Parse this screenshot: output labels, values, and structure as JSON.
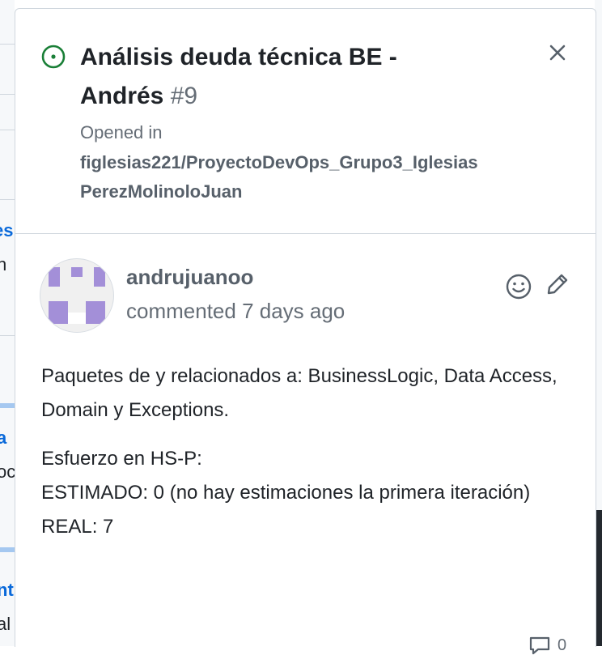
{
  "background": {
    "left_fragments": [
      "es",
      "n",
      "a",
      "oc",
      "nt",
      "al"
    ]
  },
  "issue": {
    "title": "Análisis deuda técnica BE - Andrés",
    "number": "#9",
    "opened_label": "Opened in",
    "repository": "figlesias221/ProyectoDevOps_Grupo3_IglesiasPerezMolinoloJuan",
    "status_color": "#1a7f37"
  },
  "comment": {
    "author": "andrujuanoo",
    "meta": "commented 7 days ago",
    "paragraph_1": "Paquetes de y relacionados a: BusinessLogic, Data Access, Domain y Exceptions.",
    "line_1": "Esfuerzo en HS-P:",
    "line_2": "ESTIMADO: 0 (no hay estimaciones la primera iteración)",
    "line_3": "REAL: 7",
    "reply_count": "0",
    "avatar_color": "#a38fd8"
  },
  "icons": {
    "status": "issue-opened-icon",
    "close": "close-icon",
    "reaction": "smiley-icon",
    "edit": "pencil-icon",
    "comment": "comment-icon"
  }
}
